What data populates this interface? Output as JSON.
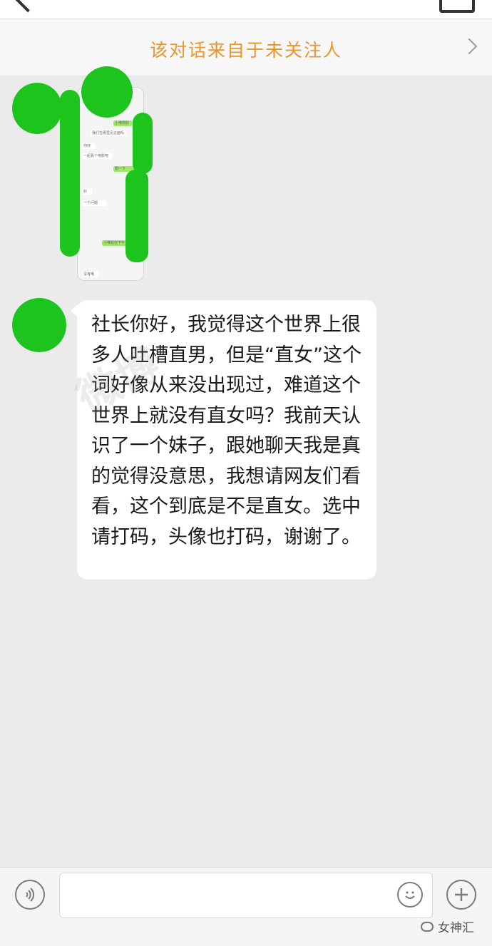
{
  "notice": {
    "text": "该对话来自于未关注人"
  },
  "screenshot_card": {
    "lines": [
      "小唯你好",
      "我们在那里见过面吗",
      "你好",
      "一起看个电影吧",
      "想一下",
      "好",
      "一个问题",
      "小唯就在下午",
      "没有哦"
    ]
  },
  "message": {
    "text": "社长你好，我觉得这个世界上很多人吐槽直男，但是“直女”这个词好像从来没出现过，难道这个世界上就没有直女吗？我前天认识了一个妹子，跟她聊天我是真的觉得没意思，我想请网友们看看，这个到底是不是直女。选中请打码，头像也打码，谢谢了。"
  },
  "watermark": {
    "text": "微博"
  },
  "input": {
    "placeholder": ""
  },
  "brand": {
    "label": "女神汇"
  },
  "colors": {
    "notice_text": "#e8962e",
    "censor_green": "#1ec41e",
    "background": "#ebebeb"
  }
}
